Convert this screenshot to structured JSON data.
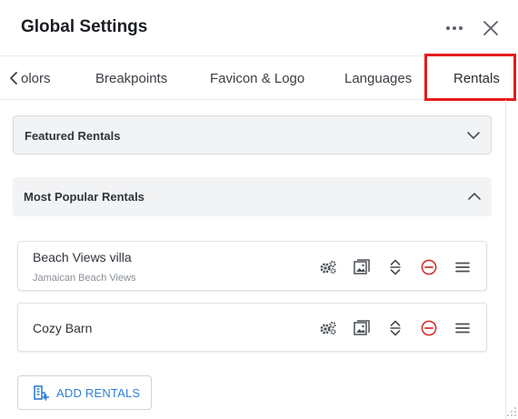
{
  "header": {
    "title": "Global Settings"
  },
  "tabs": {
    "items": [
      {
        "label": "olors"
      },
      {
        "label": "Breakpoints"
      },
      {
        "label": "Favicon & Logo"
      },
      {
        "label": "Languages"
      },
      {
        "label": "Rentals"
      }
    ],
    "active": "Rentals"
  },
  "sections": {
    "featured": {
      "label": "Featured Rentals",
      "expanded": false
    },
    "popular": {
      "label": "Most Popular Rentals",
      "expanded": true
    }
  },
  "rentals": [
    {
      "title": "Beach Views villa",
      "subtitle": "Jamaican Beach Views"
    },
    {
      "title": "Cozy Barn",
      "subtitle": ""
    }
  ],
  "add_button": {
    "label": "ADD RENTALS"
  },
  "colors": {
    "highlight": "#e51b1b",
    "accent": "#2f7fd6",
    "remove": "#d23131"
  },
  "icons": {
    "more": "more-horizontal-icon",
    "close": "close-icon",
    "tab_prev": "chevron-left-icon",
    "settings": "gears-icon",
    "image": "image-icon",
    "expand": "expand-collapse-icon",
    "remove": "remove-circle-icon",
    "drag": "drag-handle-icon",
    "add": "add-building-icon"
  }
}
